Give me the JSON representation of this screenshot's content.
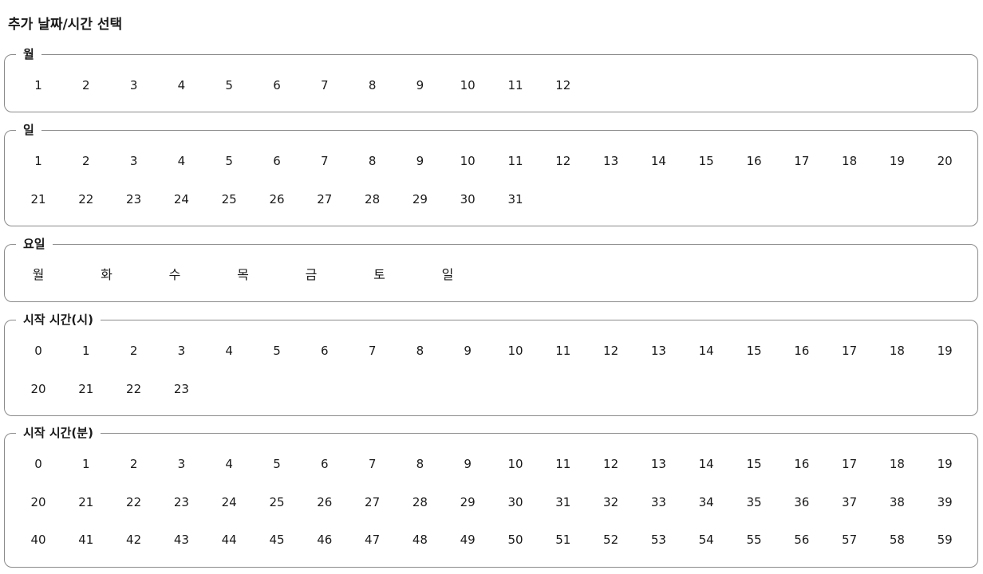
{
  "title": "추가 날짜/시간 선택",
  "sections": {
    "month": {
      "legend": "월",
      "options": [
        "1",
        "2",
        "3",
        "4",
        "5",
        "6",
        "7",
        "8",
        "9",
        "10",
        "11",
        "12"
      ]
    },
    "day": {
      "legend": "일",
      "options": [
        "1",
        "2",
        "3",
        "4",
        "5",
        "6",
        "7",
        "8",
        "9",
        "10",
        "11",
        "12",
        "13",
        "14",
        "15",
        "16",
        "17",
        "18",
        "19",
        "20",
        "21",
        "22",
        "23",
        "24",
        "25",
        "26",
        "27",
        "28",
        "29",
        "30",
        "31"
      ]
    },
    "weekday": {
      "legend": "요일",
      "options": [
        "월",
        "화",
        "수",
        "목",
        "금",
        "토",
        "일"
      ]
    },
    "hour": {
      "legend": "시작 시간(시)",
      "options": [
        "0",
        "1",
        "2",
        "3",
        "4",
        "5",
        "6",
        "7",
        "8",
        "9",
        "10",
        "11",
        "12",
        "13",
        "14",
        "15",
        "16",
        "17",
        "18",
        "19",
        "20",
        "21",
        "22",
        "23"
      ]
    },
    "minute": {
      "legend": "시작 시간(분)",
      "options": [
        "0",
        "1",
        "2",
        "3",
        "4",
        "5",
        "6",
        "7",
        "8",
        "9",
        "10",
        "11",
        "12",
        "13",
        "14",
        "15",
        "16",
        "17",
        "18",
        "19",
        "20",
        "21",
        "22",
        "23",
        "24",
        "25",
        "26",
        "27",
        "28",
        "29",
        "30",
        "31",
        "32",
        "33",
        "34",
        "35",
        "36",
        "37",
        "38",
        "39",
        "40",
        "41",
        "42",
        "43",
        "44",
        "45",
        "46",
        "47",
        "48",
        "49",
        "50",
        "51",
        "52",
        "53",
        "54",
        "55",
        "56",
        "57",
        "58",
        "59"
      ]
    }
  }
}
